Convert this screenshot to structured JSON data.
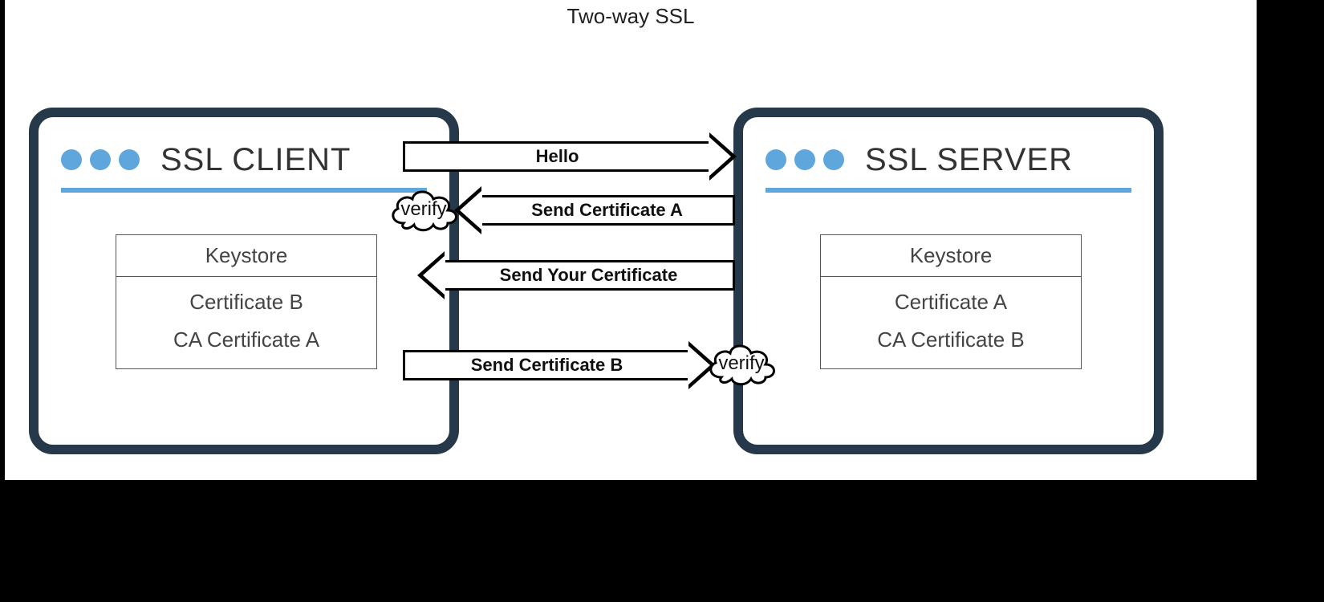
{
  "title": "Two-way SSL",
  "client": {
    "title": "SSL CLIENT",
    "keystore_label": "Keystore",
    "cert1": "Certificate B",
    "cert2": "CA Certificate A"
  },
  "server": {
    "title": "SSL SERVER",
    "keystore_label": "Keystore",
    "cert1": "Certificate A",
    "cert2": "CA Certificate B"
  },
  "arrows": {
    "hello": "Hello",
    "send_cert_a": "Send Certificate A",
    "send_your_cert": "Send Your Certificate",
    "send_cert_b": "Send Certificate B"
  },
  "clouds": {
    "verify1": "verify",
    "verify2": "verify"
  }
}
